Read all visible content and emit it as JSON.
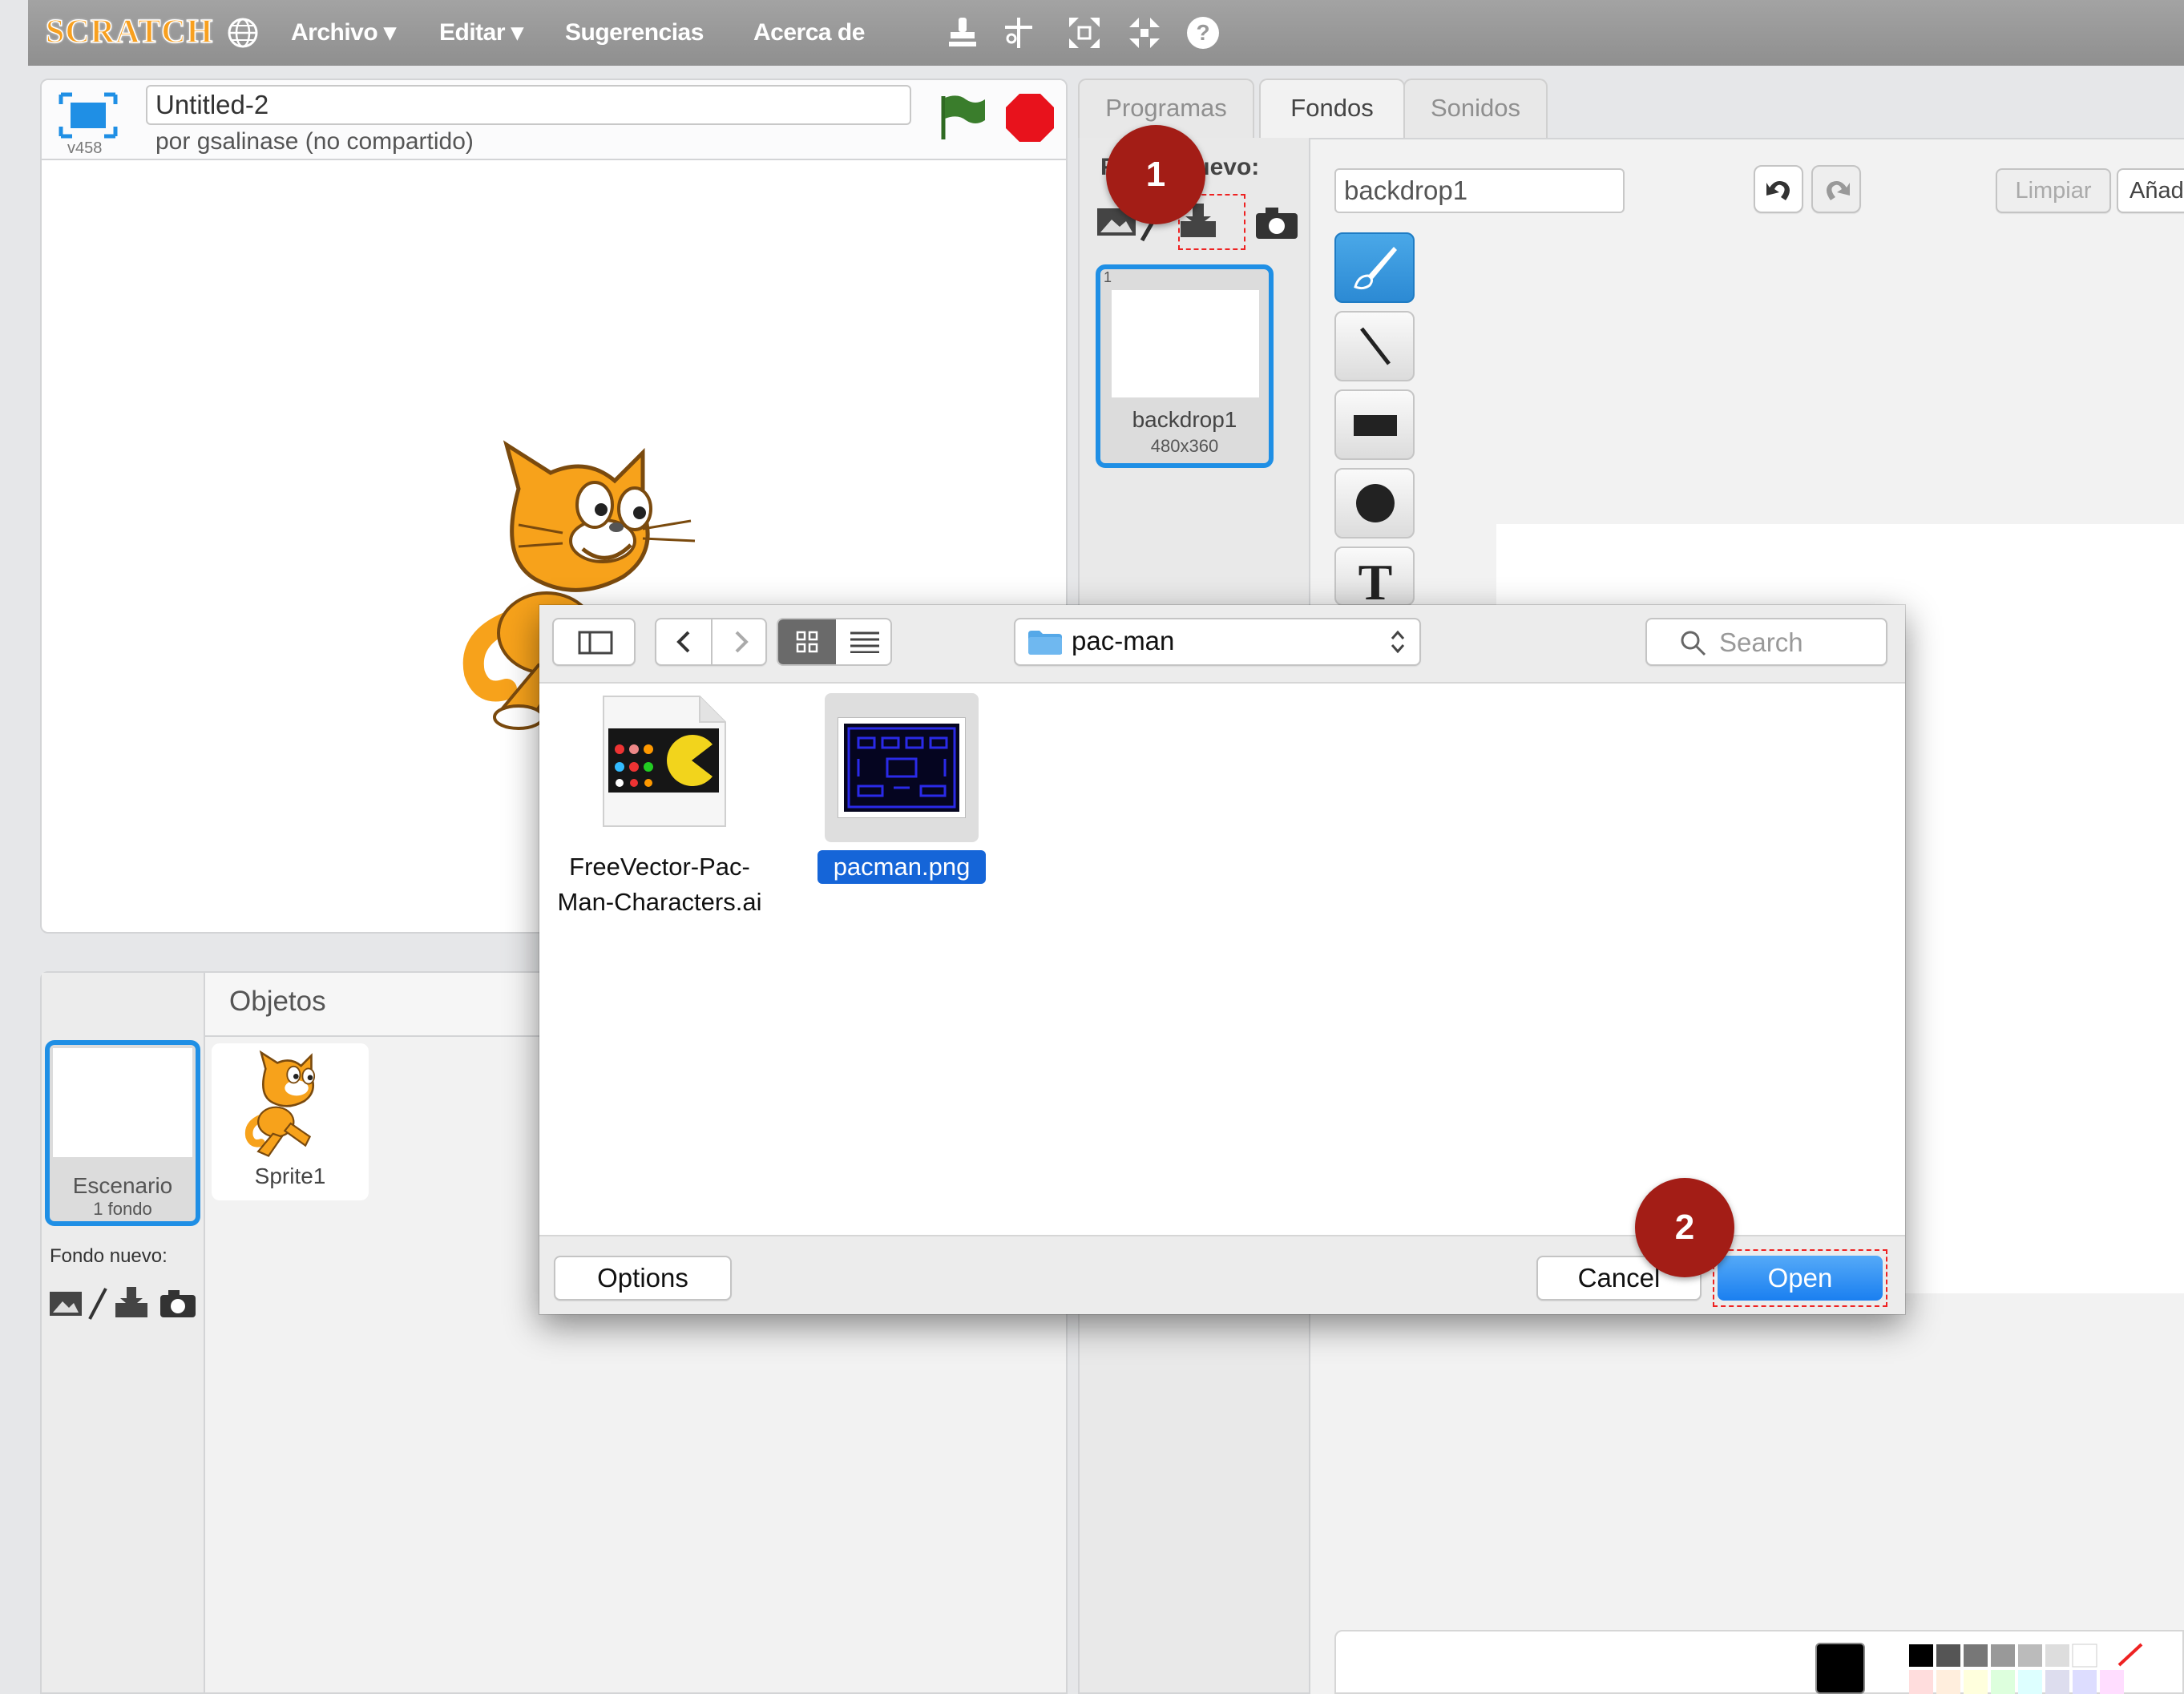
{
  "menubar": {
    "logo": "SCRATCH",
    "items": [
      "Archivo ▾",
      "Editar ▾",
      "Sugerencias",
      "Acerca de"
    ]
  },
  "stage": {
    "title": "Untitled-2",
    "byline": "por gsalinase (no compartido)",
    "version": "v458"
  },
  "sprites": {
    "header": "Objetos",
    "stage_label": "Escenario",
    "stage_sub": "1 fondo",
    "new_backdrop": "Fondo nuevo:",
    "sprite_name": "Sprite1"
  },
  "tabs": [
    "Programas",
    "Fondos",
    "Sonidos"
  ],
  "costumes": {
    "new_label": "Fondo nuevo:",
    "item_index": "1",
    "item_name": "backdrop1",
    "item_size": "480x360"
  },
  "editor": {
    "name_value": "backdrop1",
    "clear_label": "Limpiar",
    "add_label": "Añad"
  },
  "dialog": {
    "folder": "pac-man",
    "search_placeholder": "Search",
    "files": [
      {
        "name": "FreeVector-Pac-Man-Characters.ai",
        "line1": "FreeVector-Pac-",
        "line2": "Man-Characters.ai"
      },
      {
        "name": "pacman.png"
      }
    ],
    "options_label": "Options",
    "cancel_label": "Cancel",
    "open_label": "Open"
  },
  "badges": [
    "1",
    "2"
  ],
  "colors": {
    "menubar": "#9b9b9b",
    "accent_blue": "#1f8fe5",
    "badge_red": "#a31d16",
    "stop_red": "#e8121c",
    "flag_green": "#3a7d2c"
  }
}
